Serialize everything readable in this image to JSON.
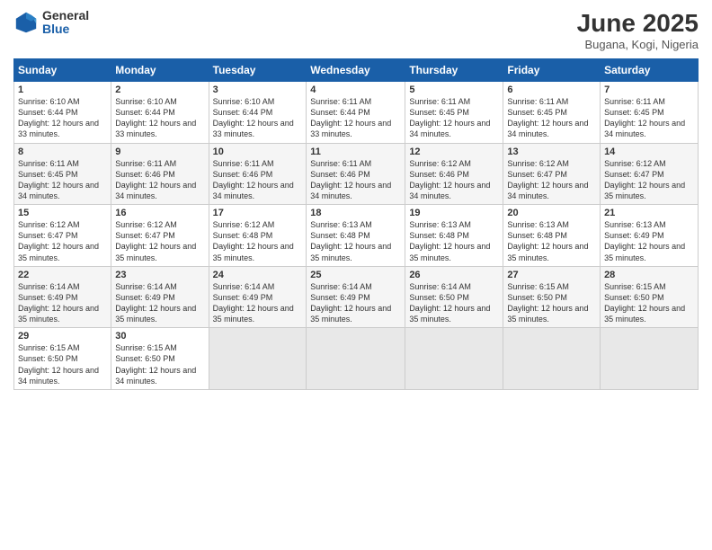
{
  "logo": {
    "general": "General",
    "blue": "Blue"
  },
  "header": {
    "title": "June 2025",
    "subtitle": "Bugana, Kogi, Nigeria"
  },
  "weekdays": [
    "Sunday",
    "Monday",
    "Tuesday",
    "Wednesday",
    "Thursday",
    "Friday",
    "Saturday"
  ],
  "weeks": [
    [
      {
        "day": "1",
        "sunrise": "6:10 AM",
        "sunset": "6:44 PM",
        "daylight": "12 hours and 33 minutes."
      },
      {
        "day": "2",
        "sunrise": "6:10 AM",
        "sunset": "6:44 PM",
        "daylight": "12 hours and 33 minutes."
      },
      {
        "day": "3",
        "sunrise": "6:10 AM",
        "sunset": "6:44 PM",
        "daylight": "12 hours and 33 minutes."
      },
      {
        "day": "4",
        "sunrise": "6:11 AM",
        "sunset": "6:44 PM",
        "daylight": "12 hours and 33 minutes."
      },
      {
        "day": "5",
        "sunrise": "6:11 AM",
        "sunset": "6:45 PM",
        "daylight": "12 hours and 34 minutes."
      },
      {
        "day": "6",
        "sunrise": "6:11 AM",
        "sunset": "6:45 PM",
        "daylight": "12 hours and 34 minutes."
      },
      {
        "day": "7",
        "sunrise": "6:11 AM",
        "sunset": "6:45 PM",
        "daylight": "12 hours and 34 minutes."
      }
    ],
    [
      {
        "day": "8",
        "sunrise": "6:11 AM",
        "sunset": "6:45 PM",
        "daylight": "12 hours and 34 minutes."
      },
      {
        "day": "9",
        "sunrise": "6:11 AM",
        "sunset": "6:46 PM",
        "daylight": "12 hours and 34 minutes."
      },
      {
        "day": "10",
        "sunrise": "6:11 AM",
        "sunset": "6:46 PM",
        "daylight": "12 hours and 34 minutes."
      },
      {
        "day": "11",
        "sunrise": "6:11 AM",
        "sunset": "6:46 PM",
        "daylight": "12 hours and 34 minutes."
      },
      {
        "day": "12",
        "sunrise": "6:12 AM",
        "sunset": "6:46 PM",
        "daylight": "12 hours and 34 minutes."
      },
      {
        "day": "13",
        "sunrise": "6:12 AM",
        "sunset": "6:47 PM",
        "daylight": "12 hours and 34 minutes."
      },
      {
        "day": "14",
        "sunrise": "6:12 AM",
        "sunset": "6:47 PM",
        "daylight": "12 hours and 35 minutes."
      }
    ],
    [
      {
        "day": "15",
        "sunrise": "6:12 AM",
        "sunset": "6:47 PM",
        "daylight": "12 hours and 35 minutes."
      },
      {
        "day": "16",
        "sunrise": "6:12 AM",
        "sunset": "6:47 PM",
        "daylight": "12 hours and 35 minutes."
      },
      {
        "day": "17",
        "sunrise": "6:12 AM",
        "sunset": "6:48 PM",
        "daylight": "12 hours and 35 minutes."
      },
      {
        "day": "18",
        "sunrise": "6:13 AM",
        "sunset": "6:48 PM",
        "daylight": "12 hours and 35 minutes."
      },
      {
        "day": "19",
        "sunrise": "6:13 AM",
        "sunset": "6:48 PM",
        "daylight": "12 hours and 35 minutes."
      },
      {
        "day": "20",
        "sunrise": "6:13 AM",
        "sunset": "6:48 PM",
        "daylight": "12 hours and 35 minutes."
      },
      {
        "day": "21",
        "sunrise": "6:13 AM",
        "sunset": "6:49 PM",
        "daylight": "12 hours and 35 minutes."
      }
    ],
    [
      {
        "day": "22",
        "sunrise": "6:14 AM",
        "sunset": "6:49 PM",
        "daylight": "12 hours and 35 minutes."
      },
      {
        "day": "23",
        "sunrise": "6:14 AM",
        "sunset": "6:49 PM",
        "daylight": "12 hours and 35 minutes."
      },
      {
        "day": "24",
        "sunrise": "6:14 AM",
        "sunset": "6:49 PM",
        "daylight": "12 hours and 35 minutes."
      },
      {
        "day": "25",
        "sunrise": "6:14 AM",
        "sunset": "6:49 PM",
        "daylight": "12 hours and 35 minutes."
      },
      {
        "day": "26",
        "sunrise": "6:14 AM",
        "sunset": "6:50 PM",
        "daylight": "12 hours and 35 minutes."
      },
      {
        "day": "27",
        "sunrise": "6:15 AM",
        "sunset": "6:50 PM",
        "daylight": "12 hours and 35 minutes."
      },
      {
        "day": "28",
        "sunrise": "6:15 AM",
        "sunset": "6:50 PM",
        "daylight": "12 hours and 35 minutes."
      }
    ],
    [
      {
        "day": "29",
        "sunrise": "6:15 AM",
        "sunset": "6:50 PM",
        "daylight": "12 hours and 34 minutes."
      },
      {
        "day": "30",
        "sunrise": "6:15 AM",
        "sunset": "6:50 PM",
        "daylight": "12 hours and 34 minutes."
      },
      null,
      null,
      null,
      null,
      null
    ]
  ]
}
